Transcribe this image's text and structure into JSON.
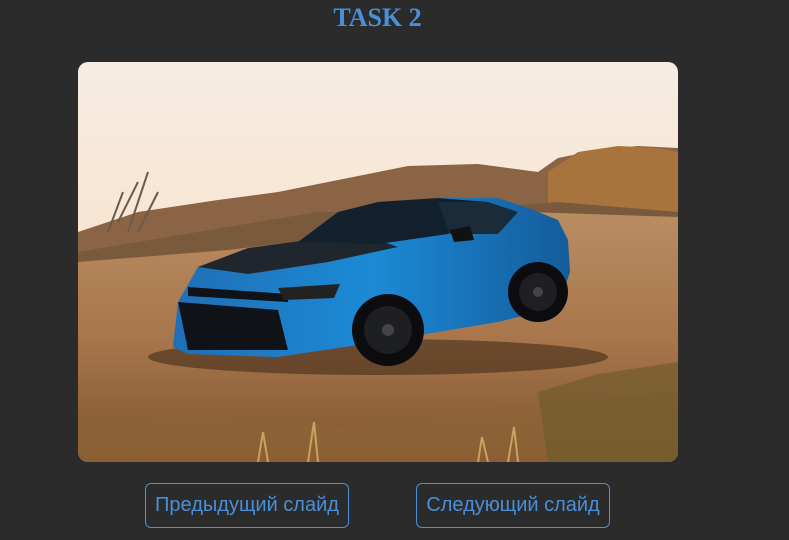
{
  "page": {
    "title": "TASK 2"
  },
  "slideshow": {
    "current_image": "blue-sports-car-in-desert-photo",
    "prev_label": "Предыдущий слайд",
    "next_label": "Следующий слайд"
  },
  "colors": {
    "accent": "#4a8fd9",
    "background": "#2b2b2b"
  }
}
